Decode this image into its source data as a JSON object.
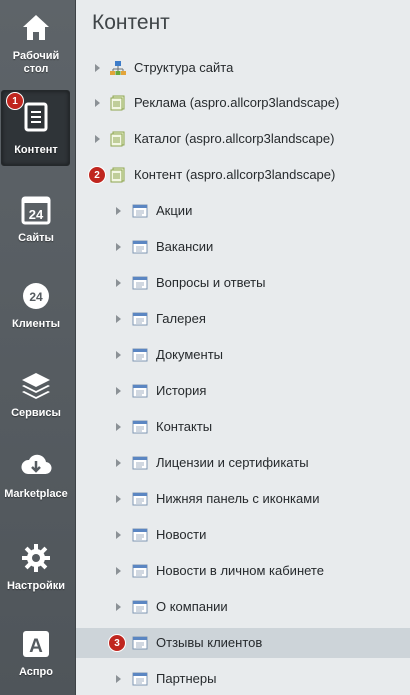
{
  "sidebar": {
    "items": [
      {
        "label": "Рабочий стол",
        "icon": "home-icon"
      },
      {
        "label": "Контент",
        "icon": "document-icon",
        "badge": "1"
      },
      {
        "label": "Сайты",
        "icon": "calendar-24-icon"
      },
      {
        "label": "Клиенты",
        "icon": "cloud-24-icon"
      },
      {
        "label": "Сервисы",
        "icon": "layers-icon"
      },
      {
        "label": "Marketplace",
        "icon": "cloud-download-icon"
      },
      {
        "label": "Настройки",
        "icon": "gear-icon"
      },
      {
        "label": "Аспро",
        "icon": "letter-a-icon"
      }
    ]
  },
  "main": {
    "title": "Контент",
    "tree": [
      {
        "label": "Структура сайта",
        "icon": "site-structure-icon"
      },
      {
        "label": "Реклама (aspro.allcorp3landscape)",
        "icon": "iblock-type-icon"
      },
      {
        "label": "Каталог (aspro.allcorp3landscape)",
        "icon": "iblock-type-icon"
      },
      {
        "label": "Контент (aspro.allcorp3landscape)",
        "icon": "iblock-type-icon",
        "badge": "2"
      },
      {
        "label": "Акции",
        "icon": "iblock-icon"
      },
      {
        "label": "Вакансии",
        "icon": "iblock-icon"
      },
      {
        "label": "Вопросы и ответы",
        "icon": "iblock-icon"
      },
      {
        "label": "Галерея",
        "icon": "iblock-icon"
      },
      {
        "label": "Документы",
        "icon": "iblock-icon"
      },
      {
        "label": "История",
        "icon": "iblock-icon"
      },
      {
        "label": "Контакты",
        "icon": "iblock-icon"
      },
      {
        "label": "Лицензии и сертификаты",
        "icon": "iblock-icon"
      },
      {
        "label": "Нижняя панель с иконками",
        "icon": "iblock-icon"
      },
      {
        "label": "Новости",
        "icon": "iblock-icon"
      },
      {
        "label": "Новости в личном кабинете",
        "icon": "iblock-icon"
      },
      {
        "label": "О компании",
        "icon": "iblock-icon"
      },
      {
        "label": "Отзывы клиентов",
        "icon": "iblock-icon",
        "badge": "3",
        "selected": true
      },
      {
        "label": "Партнеры",
        "icon": "iblock-icon"
      }
    ]
  },
  "colors": {
    "badge": "#c0261f",
    "sidebar": "#565c61",
    "selected_row": "#cdd4d9"
  }
}
